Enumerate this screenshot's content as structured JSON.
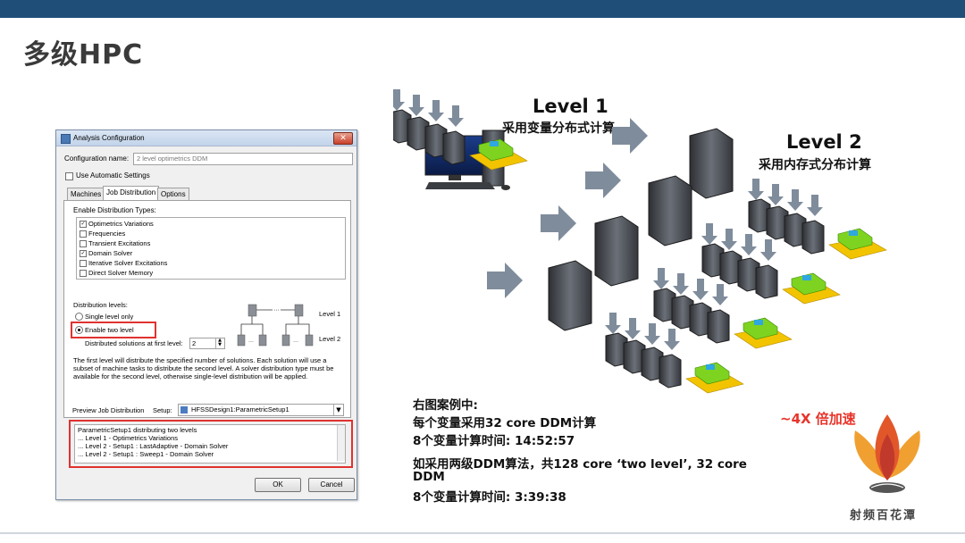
{
  "slide": {
    "title": "多级HPC"
  },
  "dialog": {
    "title": "Analysis Configuration",
    "close_glyph": "✕",
    "config_name_label": "Configuration name:",
    "config_name_value": "2 level optimetrics DDM",
    "auto_settings_label": "Use Automatic Settings",
    "tabs": [
      "Machines",
      "Job Distribution",
      "Options"
    ],
    "enable_types_label": "Enable Distribution Types:",
    "distribution_types": [
      {
        "label": "Optimetrics Variations",
        "checked": true
      },
      {
        "label": "Frequencies",
        "checked": false
      },
      {
        "label": "Transient Excitations",
        "checked": false
      },
      {
        "label": "Domain Solver",
        "checked": true
      },
      {
        "label": "Iterative Solver Excitations",
        "checked": false
      },
      {
        "label": "Direct Solver Memory",
        "checked": false
      }
    ],
    "distribution_levels_label": "Distribution levels:",
    "single_level_label": "Single level only",
    "two_level_label": "Enable two level",
    "first_level_label": "Distributed solutions at first level:",
    "first_level_value": "2",
    "diagram_level1": "Level 1",
    "diagram_level2": "Level 2",
    "description": "The first level will distribute the specified number of solutions. Each solution will use a subset of machine tasks to distribute the second level. A solver distribution type must be available for the second level, otherwise single-level distribution will be applied.",
    "preview_label": "Preview Job Distribution",
    "setup_label": "Setup:",
    "setup_value": "HFSSDesign1:ParametricSetup1",
    "preview_lines": [
      "ParametricSetup1 distributing two levels",
      "... Level 1 - Optimetrics Variations",
      "... Level 2 - Setup1 : LastAdaptive - Domain Solver",
      "... Level 2 - Setup1 : Sweep1 - Domain Solver"
    ],
    "ok_label": "OK",
    "cancel_label": "Cancel"
  },
  "illustration": {
    "level1_title": "Level 1",
    "level1_sub": "采用变量分布式计算",
    "level2_title": "Level 2",
    "level2_sub": "采用内存式分布计算"
  },
  "case": {
    "heading": "右图案例中:",
    "line1": "每个变量采用32 core DDM计算",
    "line2": "8个变量计算时间: 14:52:57",
    "line3": "如采用两级DDM算法，共128 core ‘two level’, 32 core",
    "line4": "DDM",
    "line5": "8个变量计算时间: 3:39:38"
  },
  "speedup": "~4X 倍加速",
  "logo": {
    "text": "射频百花潭"
  },
  "colors": {
    "header_bar": "#1f4e79",
    "highlight_red": "#e0322f",
    "arrow_gray": "#7f8c9b",
    "speedup_red": "#e8342a"
  }
}
